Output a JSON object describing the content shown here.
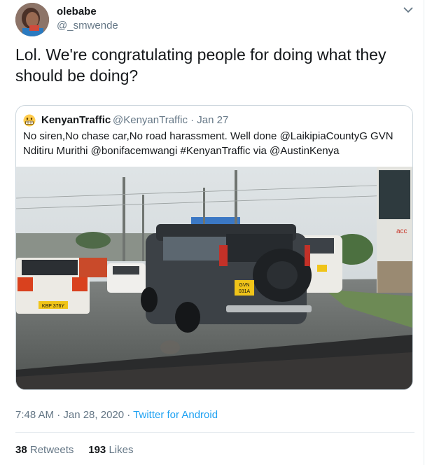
{
  "author": {
    "display_name": "olebabe",
    "handle": "@_smwende"
  },
  "tweet": {
    "text": "Lol. We're congratulating people for doing what they should be doing?"
  },
  "quoted": {
    "emoji_icon": "grimacing-face-emoji",
    "display_name": "KenyanTraffic",
    "handle_date": "@KenyanTraffic · Jan 27",
    "text": "No siren,No chase car,No road harassment. Well done @LaikipiaCountyG GVN Nditiru Murithi @bonifacemwangi #KenyanTraffic  via @AustinKenya",
    "media": {
      "plate_front": "GVN\n031A",
      "plate_left": "KBP 376Y",
      "truck_label": "acc"
    }
  },
  "meta": {
    "timestamp": "7:48 AM · Jan 28, 2020 · ",
    "source": "Twitter for Android"
  },
  "stats": {
    "retweets_count": "38",
    "retweets_label": "Retweets",
    "likes_count": "193",
    "likes_label": "Likes"
  },
  "colors": {
    "link": "#1da1f2",
    "secondary": "#657786",
    "border": "#ccd6dd"
  }
}
